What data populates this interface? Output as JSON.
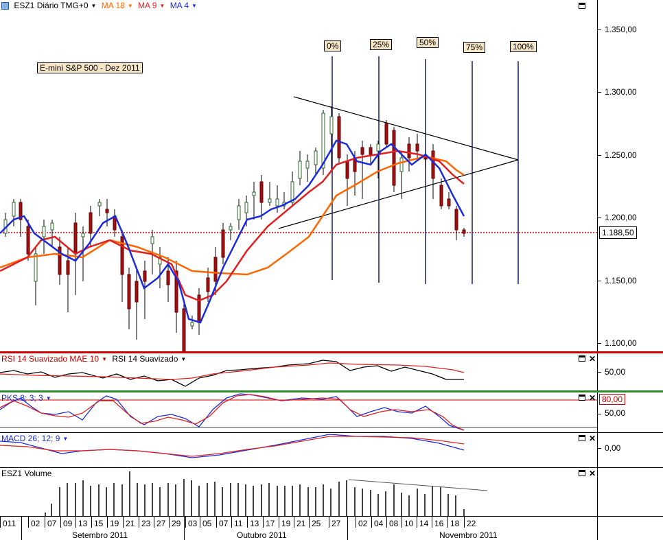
{
  "main": {
    "symbol": "ESZ1 Diário TMG+0",
    "indicators": [
      {
        "label": "MA 18",
        "color": "#ff6600"
      },
      {
        "label": "MA 9",
        "color": "#e02020"
      },
      {
        "label": "MA 4",
        "color": "#1a2bdc"
      }
    ],
    "note": "E-mini S&P 500 - Dez 2011",
    "fib_labels": [
      "0%",
      "25%",
      "50%",
      "75%",
      "100%"
    ],
    "price_ticks": [
      "1.350,00",
      "1.300,00",
      "1.250,00",
      "1.200,00",
      "1.150,00",
      "1.100,00"
    ],
    "last_price": "1.188,50"
  },
  "rsi": {
    "label_smoothed": "RSI 14 Suavizado MAE 10",
    "label_rsi": "RSI 14 Suavizado",
    "tick": "50,00"
  },
  "stoch": {
    "label": "PKS 8; 3; 3",
    "overbought": "80,00",
    "tick": "50,00"
  },
  "macd": {
    "label": "MACD 26; 12; 9",
    "tick": "0,00"
  },
  "volume": {
    "label": "ESZ1 Volume"
  },
  "dates": {
    "days": [
      "011",
      "02",
      "07",
      "09",
      "13",
      "15",
      "19",
      "21",
      "23",
      "27",
      "29",
      "03",
      "05",
      "07",
      "11",
      "13",
      "17",
      "19",
      "21",
      "25",
      "27",
      "02",
      "04",
      "08",
      "10",
      "14",
      "16",
      "18",
      "22"
    ],
    "months": [
      "Setembro 2011",
      "Outubro 2011",
      "Novembro 2011"
    ]
  },
  "colors": {
    "up_candle": "#ffffff",
    "down_candle": "#a01010",
    "ma18": "#ff6600",
    "ma9": "#e02020",
    "ma4": "#1a2bdc",
    "fib_line": "#1a1a6e"
  }
}
